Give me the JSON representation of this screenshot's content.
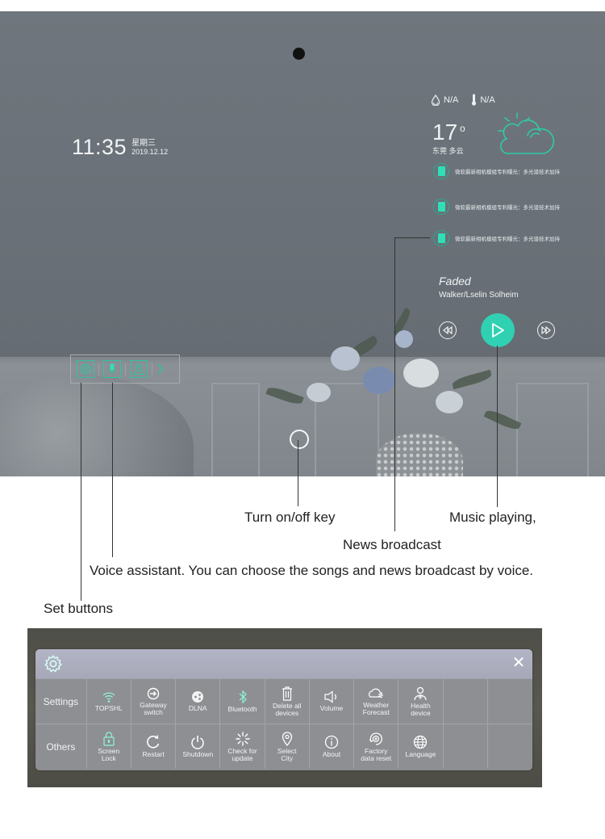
{
  "mirror": {
    "clock": {
      "time": "11:35",
      "weekday": "星期三",
      "date": "2019.12.12"
    },
    "weather": {
      "humidity_icon": "droplet-icon",
      "humidity": "N/A",
      "thermometer_icon": "thermometer-icon",
      "indoor_temp": "N/A",
      "temperature": "17",
      "degree_symbol": "o",
      "location": "东莞",
      "condition": "多云",
      "condition_icon": "partly-cloudy-icon"
    },
    "news": [
      {
        "text": "微软最新相机模组专利曝光：多光谱技术加持"
      },
      {
        "text": "微软最新相机模组专利曝光：多光谱技术加持"
      },
      {
        "text": "微软最新相机模组专利曝光：多光谱技术加持"
      }
    ],
    "music": {
      "title": "Faded",
      "artist": "Walker/Lselin Solheim",
      "prev_icon": "rewind-icon",
      "play_icon": "play-icon",
      "next_icon": "fast-forward-icon"
    },
    "toolbar": {
      "items": [
        "gear-icon",
        "microphone-icon",
        "map-pin-icon",
        "chevron-right-icon"
      ]
    },
    "power_key_icon": "power-circle-icon",
    "accent_color": "#2fd1b2"
  },
  "callouts": {
    "power": "Turn on/off key",
    "music": "Music playing,",
    "news": "News broadcast",
    "voice": "Voice assistant. You can choose the songs and  news broadcast by voice.",
    "settings": "Set buttons"
  },
  "settings_panel": {
    "header_icon": "gear-icon",
    "close_label": "✕",
    "rows": [
      {
        "label": "Settings",
        "items": [
          {
            "label": "TOPSHL",
            "icon": "wifi-icon"
          },
          {
            "label": "Gateway\nswitch",
            "icon": "gateway-switch-icon"
          },
          {
            "label": "DLNA",
            "icon": "dlna-icon"
          },
          {
            "label": "Bluetooth",
            "icon": "bluetooth-icon"
          },
          {
            "label": "Delete all\ndevices",
            "icon": "trash-icon"
          },
          {
            "label": "Volume",
            "icon": "speaker-icon"
          },
          {
            "label": "Weather\nForecast",
            "icon": "weather-icon"
          },
          {
            "label": "Health\ndevice",
            "icon": "health-person-icon"
          },
          {
            "label": "",
            "icon": ""
          },
          {
            "label": "",
            "icon": ""
          }
        ]
      },
      {
        "label": "Others",
        "items": [
          {
            "label": "Screen\nLock",
            "icon": "lock-icon"
          },
          {
            "label": "Restart",
            "icon": "restart-icon"
          },
          {
            "label": "Shutdown",
            "icon": "power-icon"
          },
          {
            "label": "Check for\nupdate",
            "icon": "update-spinner-icon"
          },
          {
            "label": "Select\nCity",
            "icon": "location-pin-icon"
          },
          {
            "label": "About",
            "icon": "info-icon"
          },
          {
            "label": "Factory\ndata reset",
            "icon": "factory-reset-icon"
          },
          {
            "label": "Language",
            "icon": "globe-icon"
          },
          {
            "label": "",
            "icon": ""
          },
          {
            "label": "",
            "icon": ""
          }
        ]
      }
    ]
  }
}
